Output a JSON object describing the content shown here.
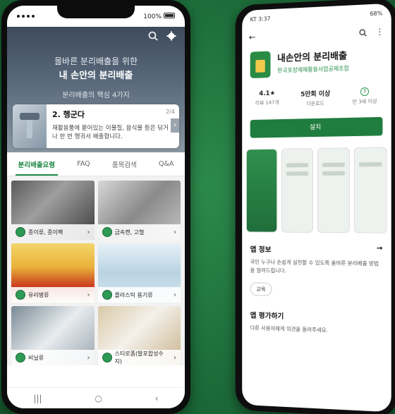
{
  "left_phone": {
    "status": {
      "battery_text": "100%"
    },
    "hero": {
      "subtitle": "올바른 분리배출을 위한",
      "title": "내 손안의 분리배출",
      "tagline": "분리배출의 핵심 4가지"
    },
    "tip_card": {
      "title": "2. 헹군다",
      "page": "2/4",
      "description": "재활용품에 묻어있는 이물질, 음식물 등은 닦거나 한 번 헹궈서 배출합니다.",
      "next_label": "›"
    },
    "tabs": [
      {
        "label": "분리배출요령"
      },
      {
        "label": "FAQ"
      },
      {
        "label": "품목검색"
      },
      {
        "label": "Q&A"
      }
    ],
    "categories": [
      {
        "label": "종이류, 종이팩"
      },
      {
        "label": "금속캔, 고철"
      },
      {
        "label": "유리병류"
      },
      {
        "label": "플라스틱 용기류"
      },
      {
        "label": "비닐류"
      },
      {
        "label": "스티로폼(발포합성수지)"
      }
    ],
    "navbar": {
      "recent": "|||",
      "home": "○",
      "back": "‹"
    }
  },
  "right_phone": {
    "status": {
      "time": "KT 3:37",
      "right": "68%"
    },
    "app": {
      "name": "내손안의 분리배출",
      "developer": "한국포장재재활용사업공제조합"
    },
    "stats": [
      {
        "value": "4.1★",
        "key": "리뷰 147개"
      },
      {
        "value": "5만회 이상",
        "key": "다운로드"
      },
      {
        "value": "",
        "key": "만 3세 이상"
      }
    ],
    "age_badge": "3",
    "install_label": "설치",
    "about": {
      "title": "앱 정보",
      "arrow": "→",
      "description": "국민 누구나 손쉽게 실천할 수 있도록 올바른 분리배출 방법을 알려드립니다.",
      "chip": "교육"
    },
    "rating": {
      "title": "앱 평가하기",
      "description": "다른 사용자에게 의견을 들려주세요."
    }
  }
}
